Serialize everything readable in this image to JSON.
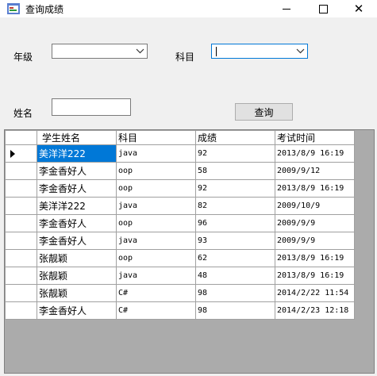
{
  "window": {
    "title": "查询成绩"
  },
  "form": {
    "grade_label": "年级",
    "subject_label": "科目",
    "name_label": "姓名",
    "grade_value": "",
    "subject_value": "",
    "name_value": "",
    "query_button": "查询"
  },
  "grid": {
    "columns": [
      "学生姓名",
      "科目",
      "成绩",
      "考试时间"
    ],
    "selected_row": 0,
    "rows": [
      {
        "name": "美洋洋222",
        "subject": "java",
        "score": "92",
        "time": "2013/8/9 16:19"
      },
      {
        "name": "李金香好人",
        "subject": "oop",
        "score": "58",
        "time": "2009/9/12"
      },
      {
        "name": "李金香好人",
        "subject": "oop",
        "score": "92",
        "time": "2013/8/9 16:19"
      },
      {
        "name": "美洋洋222",
        "subject": "java",
        "score": "82",
        "time": "2009/10/9"
      },
      {
        "name": "李金香好人",
        "subject": "oop",
        "score": "96",
        "time": "2009/9/9"
      },
      {
        "name": "李金香好人",
        "subject": "java",
        "score": "93",
        "time": "2009/9/9"
      },
      {
        "name": "张靓颖",
        "subject": "oop",
        "score": "62",
        "time": "2013/8/9 16:19"
      },
      {
        "name": "张靓颖",
        "subject": "java",
        "score": "48",
        "time": "2013/8/9 16:19"
      },
      {
        "name": "张靓颖",
        "subject": "C#",
        "score": "98",
        "time": "2014/2/22 11:54"
      },
      {
        "name": "李金香好人",
        "subject": "C#",
        "score": "98",
        "time": "2014/2/23 12:18"
      }
    ]
  }
}
